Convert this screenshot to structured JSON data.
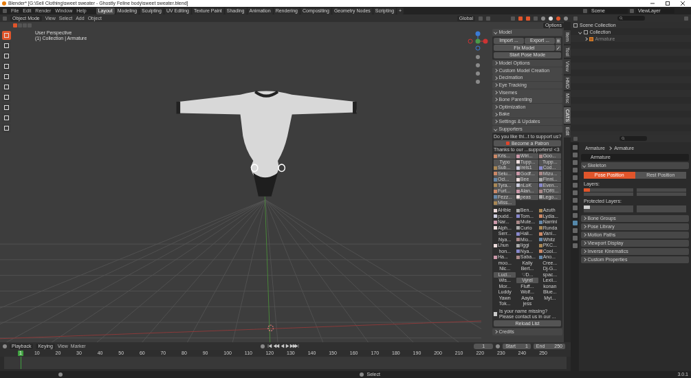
{
  "window": {
    "title": "Blender* [G:\\Sell Clothing\\sweet sweater - Ghostly Feline body\\sweet sweater.blend]"
  },
  "menu": [
    "File",
    "Edit",
    "Render",
    "Window",
    "Help"
  ],
  "workspaces": [
    {
      "label": "Layout",
      "selected": true
    },
    {
      "label": "Modeling",
      "selected": false
    },
    {
      "label": "Sculpting",
      "selected": false
    },
    {
      "label": "UV Editing",
      "selected": false
    },
    {
      "label": "Texture Paint",
      "selected": false
    },
    {
      "label": "Shading",
      "selected": false
    },
    {
      "label": "Animation",
      "selected": false
    },
    {
      "label": "Rendering",
      "selected": false
    },
    {
      "label": "Compositing",
      "selected": false
    },
    {
      "label": "Geometry Nodes",
      "selected": false
    },
    {
      "label": "Scripting",
      "selected": false
    }
  ],
  "add_workspace": "+",
  "viewport": {
    "mode": "Object Mode",
    "menus": [
      "View",
      "Select",
      "Add",
      "Object"
    ],
    "orientation": "Global",
    "options": "Options",
    "perspective": "User Perspective",
    "context": "(1) Collection | Armature",
    "tools": [
      {
        "selected": true
      },
      {
        "selected": false
      },
      {
        "selected": false
      },
      {
        "selected": false
      },
      {
        "selected": false
      },
      {
        "selected": false
      },
      {
        "selected": false
      },
      {
        "selected": false
      },
      {
        "selected": false
      },
      {
        "selected": false
      }
    ]
  },
  "n_panel": {
    "tabs": [
      {
        "label": "Item",
        "selected": false
      },
      {
        "label": "Tool",
        "selected": false
      },
      {
        "label": "View",
        "selected": false
      },
      {
        "label": "HMD",
        "selected": false
      },
      {
        "label": "Misc",
        "selected": false
      },
      {
        "label": "CATS",
        "selected": true
      },
      {
        "label": "Edit",
        "selected": false
      }
    ],
    "model_header": "Model",
    "import": "Import ...",
    "export": "Export ...",
    "fix_model": "Fix Model",
    "start_pose": "Start Pose Mode",
    "sections": [
      "Model Options",
      "Custom Model Creation",
      "Decimation",
      "Eye Tracking",
      "Visemes",
      "Bone Parenting",
      "Optimization",
      "Bake",
      "Settings & Updates"
    ],
    "supporters_header": "Supporters",
    "support_prompt": "Do you like thi...t to support us?",
    "patron_button": "Become a Patron",
    "thanks": "Thanks to our ...supporters! <3",
    "patrons": [
      {
        "name": "Kris...",
        "kind": "icon"
      },
      {
        "name": "Wiri...",
        "kind": "icon"
      },
      {
        "name": "Goo...",
        "kind": "icon"
      },
      {
        "name": "Typo",
        "kind": "plain"
      },
      {
        "name": "Tupp...",
        "kind": "icon"
      },
      {
        "name": "Tupp...",
        "kind": "plain"
      },
      {
        "name": "Sub...",
        "kind": "icon"
      },
      {
        "name": "irels1",
        "kind": "icon"
      },
      {
        "name": "Cod...",
        "kind": "icon"
      },
      {
        "name": "Seiu...",
        "kind": "icon"
      },
      {
        "name": "Godf...",
        "kind": "icon"
      },
      {
        "name": "Mizu...",
        "kind": "icon"
      },
      {
        "name": "Oci...",
        "kind": "icon"
      },
      {
        "name": "Bee",
        "kind": "icon"
      },
      {
        "name": "Finni...",
        "kind": "icon"
      },
      {
        "name": "Tyra...",
        "kind": "icon"
      },
      {
        "name": "nLoK",
        "kind": "icon"
      },
      {
        "name": "Even...",
        "kind": "icon"
      },
      {
        "name": "Furt...",
        "kind": "icon"
      },
      {
        "name": "Alan...",
        "kind": "icon"
      },
      {
        "name": "TORI...",
        "kind": "icon"
      },
      {
        "name": "Fezz...",
        "kind": "icon"
      },
      {
        "name": "peas",
        "kind": "icon"
      },
      {
        "name": "Lego...",
        "kind": "icon"
      },
      {
        "name": "Miss...",
        "kind": "icon"
      }
    ],
    "supporters": [
      {
        "name": "AHble",
        "kind": "icon"
      },
      {
        "name": "Ben...",
        "kind": "icon"
      },
      {
        "name": "Azuth",
        "kind": "icon"
      },
      {
        "name": "pudd...",
        "kind": "icon"
      },
      {
        "name": "Tom...",
        "kind": "icon"
      },
      {
        "name": "Lydia...",
        "kind": "icon"
      },
      {
        "name": "Nar...",
        "kind": "icon"
      },
      {
        "name": "Mute...",
        "kind": "icon"
      },
      {
        "name": "Narrini",
        "kind": "icon"
      },
      {
        "name": "Alph...",
        "kind": "icon"
      },
      {
        "name": "Curio",
        "kind": "icon"
      },
      {
        "name": "Runda",
        "kind": "icon"
      },
      {
        "name": "Serr...",
        "kind": "plain"
      },
      {
        "name": "Hali...",
        "kind": "icon"
      },
      {
        "name": "Vani...",
        "kind": "icon"
      },
      {
        "name": "Nya...",
        "kind": "plain"
      },
      {
        "name": "Mio...",
        "kind": "icon"
      },
      {
        "name": "Whitz",
        "kind": "icon"
      },
      {
        "name": "Lhun",
        "kind": "icon"
      },
      {
        "name": "Iiggi",
        "kind": "icon"
      },
      {
        "name": "PKC...",
        "kind": "icon"
      },
      {
        "name": "hon...",
        "kind": "plain"
      },
      {
        "name": "Nya...",
        "kind": "icon"
      },
      {
        "name": "Cool...",
        "kind": "icon"
      },
      {
        "name": "Ha...",
        "kind": "icon"
      },
      {
        "name": "Saba...",
        "kind": "icon"
      },
      {
        "name": "Ano...",
        "kind": "icon"
      },
      {
        "name": "moo...",
        "kind": "plain"
      },
      {
        "name": "Kally",
        "kind": "plain"
      },
      {
        "name": "Cree...",
        "kind": "plain"
      },
      {
        "name": "Nic...",
        "kind": "plain"
      },
      {
        "name": "Bert...",
        "kind": "plain"
      },
      {
        "name": "Dj-G...",
        "kind": "plain"
      },
      {
        "name": "Luci...",
        "kind": "boxed"
      },
      {
        "name": "♡D...",
        "kind": "plain"
      },
      {
        "name": "spac...",
        "kind": "plain"
      },
      {
        "name": "Wis...",
        "kind": "plain"
      },
      {
        "name": "Vyrel",
        "kind": "boxed"
      },
      {
        "name": "Lexii...",
        "kind": "plain"
      },
      {
        "name": "Mor...",
        "kind": "plain"
      },
      {
        "name": "Fluff...",
        "kind": "plain"
      },
      {
        "name": "konan",
        "kind": "plain"
      },
      {
        "name": "Luddy",
        "kind": "plain"
      },
      {
        "name": "Wolf...",
        "kind": "plain"
      },
      {
        "name": "Blue...",
        "kind": "plain"
      },
      {
        "name": "Yawn",
        "kind": "plain"
      },
      {
        "name": "Aayla",
        "kind": "plain"
      },
      {
        "name": "Myt...",
        "kind": "plain"
      },
      {
        "name": "Tok...",
        "kind": "plain"
      },
      {
        "name": "jess",
        "kind": "plain"
      }
    ],
    "missing": [
      "Is your name missing?",
      "Please contact us in our ..."
    ],
    "reload": "Reload List",
    "credits": "Credits"
  },
  "outliner": {
    "scene": "Scene",
    "view_layer": "ViewLayer",
    "tree": [
      {
        "label": "Scene Collection",
        "children": [
          {
            "label": "Collection",
            "expanded": true,
            "children": [
              {
                "label": "Armature",
                "expanded": false
              }
            ]
          }
        ]
      }
    ]
  },
  "properties": {
    "breadcrumb": [
      "Armature",
      "Armature"
    ],
    "data_name": "Armature",
    "skeleton_header": "Skeleton",
    "positions": [
      {
        "label": "Pose Position",
        "selected": true
      },
      {
        "label": "Rest Position",
        "selected": false
      }
    ],
    "layers_label": "Layers:",
    "protected_label": "Protected Layers:",
    "layers": [
      true,
      false,
      false,
      false,
      false,
      false,
      false,
      false,
      false,
      false,
      false,
      false,
      false,
      false,
      false,
      false,
      false,
      false,
      false,
      false,
      false,
      false,
      false,
      false,
      false,
      false,
      false,
      false,
      false,
      false,
      false,
      false
    ],
    "protected": [
      true,
      false,
      false,
      false,
      false,
      false,
      false,
      false,
      false,
      false,
      false,
      false,
      false,
      false,
      false,
      false,
      false,
      false,
      false,
      false,
      false,
      false,
      false,
      false,
      false,
      false,
      false,
      false,
      false,
      false,
      false,
      false
    ],
    "sections": [
      "Bone Groups",
      "Pose Library",
      "Motion Paths",
      "Viewport Display",
      "Inverse Kinematics",
      "Custom Properties"
    ]
  },
  "timeline": {
    "menus": [
      "Playback",
      "Keying",
      "View",
      "Marker"
    ],
    "frame": "1",
    "start_label": "Start",
    "start": "1",
    "end_label": "End",
    "end": "250",
    "current": "1",
    "ticks": [
      "10",
      "20",
      "30",
      "40",
      "50",
      "60",
      "70",
      "80",
      "90",
      "100",
      "110",
      "120",
      "130",
      "140",
      "150",
      "160",
      "170",
      "180",
      "190",
      "200",
      "210",
      "220",
      "230",
      "240",
      "250"
    ]
  },
  "status_bar": {
    "hint": "Select",
    "version": "3.0.1"
  }
}
